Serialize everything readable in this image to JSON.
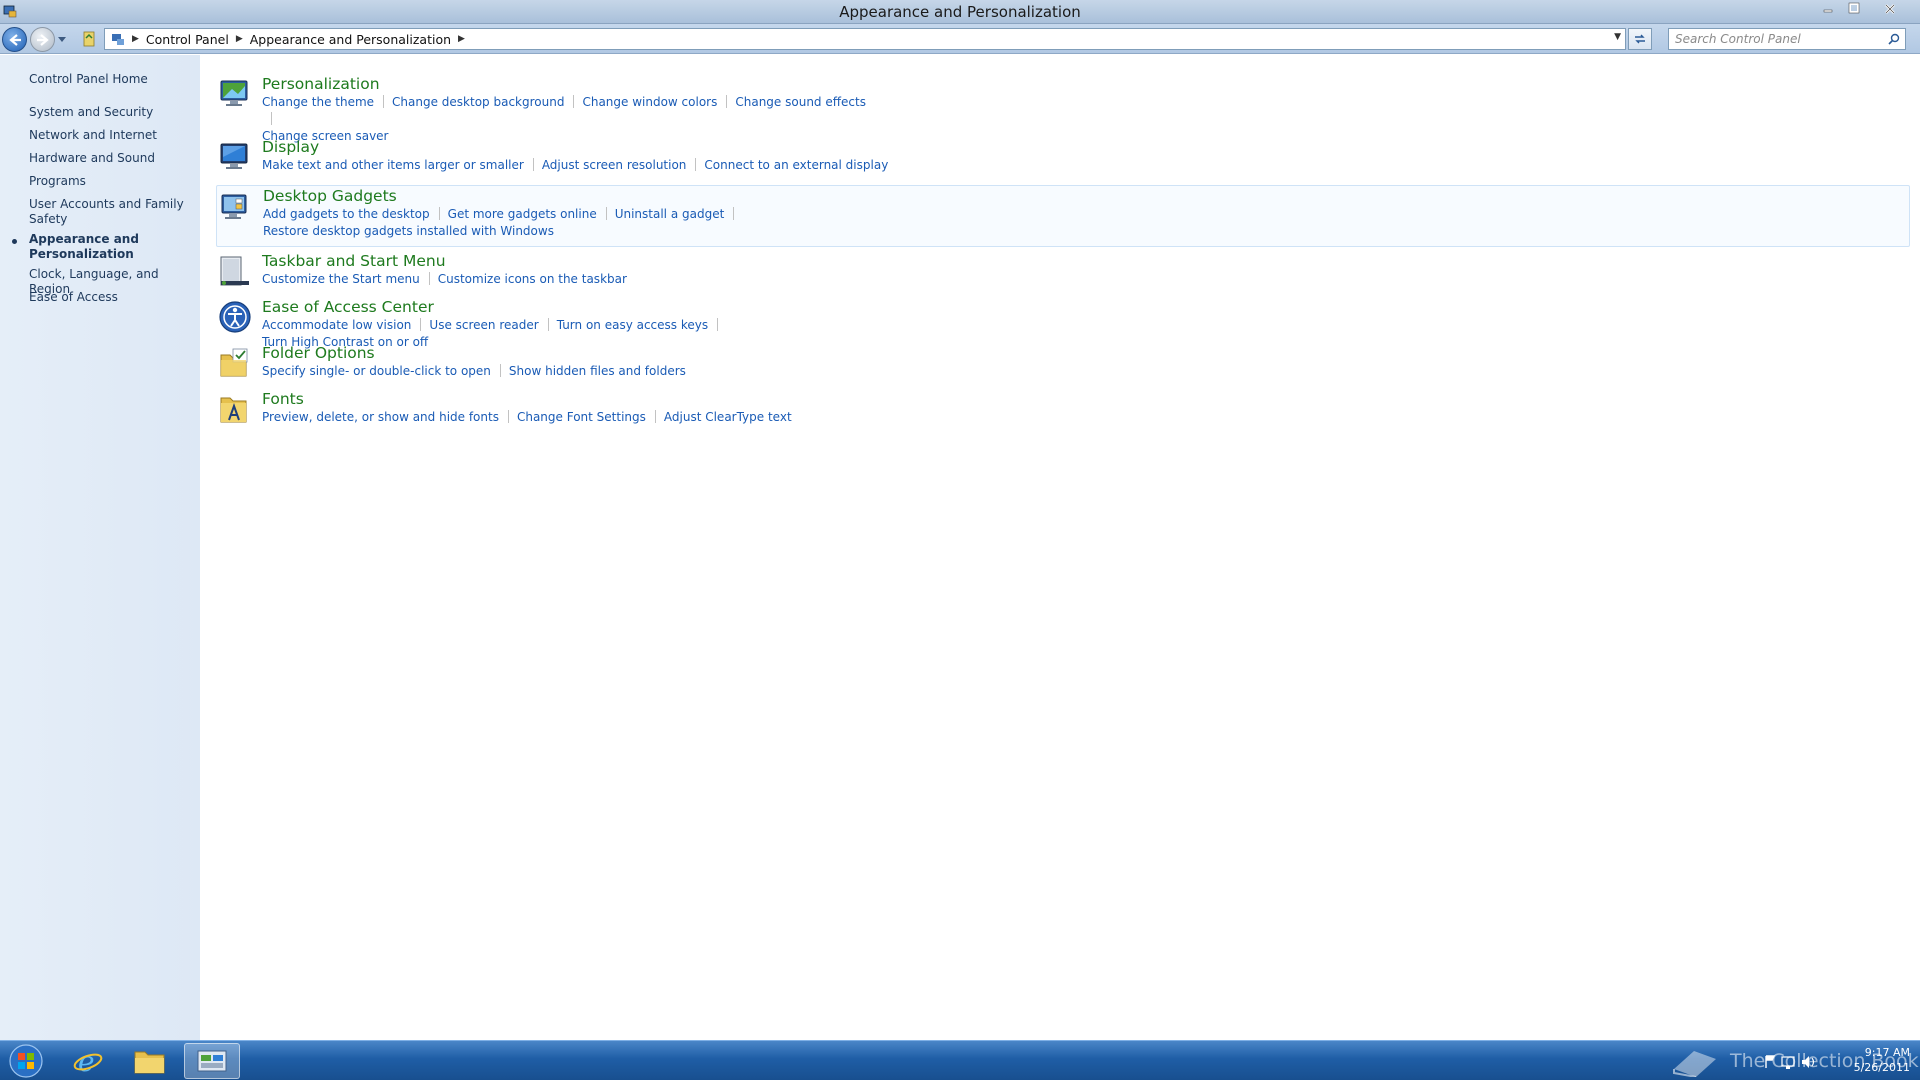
{
  "window": {
    "title": "Appearance and Personalization"
  },
  "address_bar": {
    "crumbs": [
      "Control Panel",
      "Appearance and Personalization"
    ],
    "search_placeholder": "Search Control Panel"
  },
  "sidebar": {
    "home": "Control Panel Home",
    "items": [
      {
        "label": "System and Security"
      },
      {
        "label": "Network and Internet"
      },
      {
        "label": "Hardware and Sound"
      },
      {
        "label": "Programs"
      },
      {
        "label": "User Accounts and Family Safety"
      },
      {
        "label": "Appearance and Personalization",
        "active": true
      },
      {
        "label": "Clock, Language, and Region"
      },
      {
        "label": "Ease of Access"
      }
    ]
  },
  "categories": [
    {
      "title": "Personalization",
      "icon": "personalization-icon",
      "links": [
        "Change the theme",
        "Change desktop background",
        "Change window colors",
        "Change sound effects",
        "Change screen saver"
      ]
    },
    {
      "title": "Display",
      "icon": "display-icon",
      "links": [
        "Make text and other items larger or smaller",
        "Adjust screen resolution",
        "Connect to an external display"
      ]
    },
    {
      "title": "Desktop Gadgets",
      "icon": "gadgets-icon",
      "links": [
        "Add gadgets to the desktop",
        "Get more gadgets online",
        "Uninstall a gadget",
        "Restore desktop gadgets installed with Windows"
      ]
    },
    {
      "title": "Taskbar and Start Menu",
      "icon": "taskbar-icon",
      "links": [
        "Customize the Start menu",
        "Customize icons on the taskbar"
      ]
    },
    {
      "title": "Ease of Access Center",
      "icon": "ease-of-access-icon",
      "links": [
        "Accommodate low vision",
        "Use screen reader",
        "Turn on easy access keys",
        "Turn High Contrast on or off"
      ]
    },
    {
      "title": "Folder Options",
      "icon": "folder-options-icon",
      "links": [
        "Specify single- or double-click to open",
        "Show hidden files and folders"
      ]
    },
    {
      "title": "Fonts",
      "icon": "fonts-icon",
      "links": [
        "Preview, delete, or show and hide fonts",
        "Change Font Settings",
        "Adjust ClearType text"
      ]
    }
  ],
  "taskbar": {
    "watermark": "The Collection Book",
    "time": "9:17 AM",
    "date": "5/26/2011"
  },
  "colors": {
    "link": "#1a5bb5",
    "heading": "#1e7a1e",
    "sidebar_text": "#1e395b",
    "taskbar": "#1f5ea6"
  }
}
